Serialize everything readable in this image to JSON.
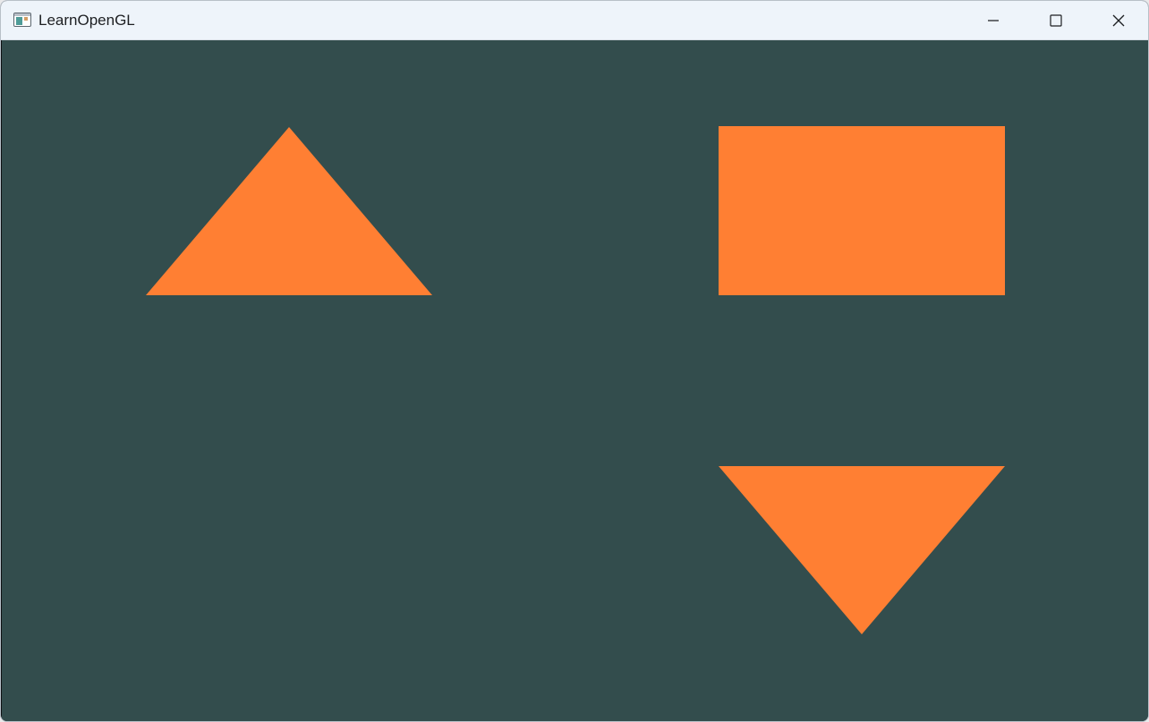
{
  "window": {
    "title": "LearnOpenGL",
    "controls": {
      "minimize": "minimize-icon",
      "maximize": "maximize-icon",
      "close": "close-icon"
    }
  },
  "scene": {
    "background_color": "#334d4d",
    "shape_color": "#ff7f33",
    "shapes": [
      {
        "name": "triangle-up",
        "type": "triangle"
      },
      {
        "name": "rectangle",
        "type": "rectangle"
      },
      {
        "name": "triangle-down",
        "type": "triangle"
      }
    ]
  }
}
